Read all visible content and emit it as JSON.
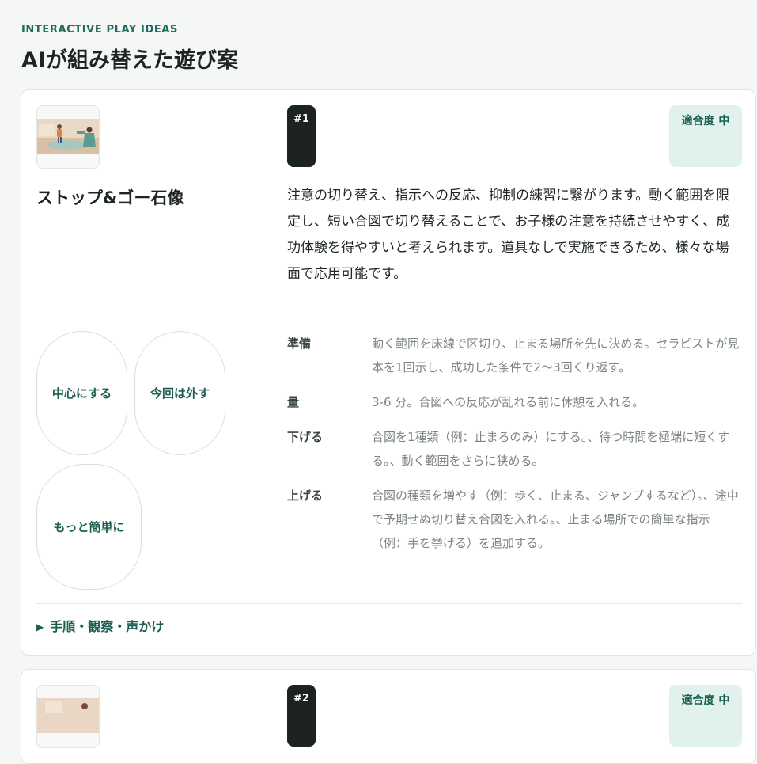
{
  "header": {
    "eyebrow": "INTERACTIVE PLAY IDEAS",
    "title": "AIが組み替えた遊び案"
  },
  "cards": [
    {
      "index_label": "#1",
      "fit_label": "適合度 中",
      "title": "ストップ&ゴー石像",
      "summary": "注意の切り替え、指示への反応、抑制の練習に繋がります。動く範囲を限定し、短い合図で切り替えることで、お子様の注意を持続させやすく、成功体験を得やすいと考えられます。道具なしで実施できるため、様々な場面で応用可能です。",
      "actions": [
        "中心にする",
        "今回は外す",
        "もっと簡単に"
      ],
      "details": [
        {
          "term": "準備",
          "text": "動く範囲を床線で区切り、止まる場所を先に決める。セラピストが見本を1回示し、成功した条件で2〜3回くり返す。"
        },
        {
          "term": "量",
          "text": "3-6 分。合図への反応が乱れる前に休憩を入れる。"
        },
        {
          "term": "下げる",
          "text": "合図を1種類（例：止まるのみ）にする。、待つ時間を極端に短くする。、動く範囲をさらに狭める。"
        },
        {
          "term": "上げる",
          "text": "合図の種類を増やす（例：歩く、止まる、ジャンプするなど）。、途中で予期せぬ切り替え合図を入れる。、止まる場所での簡単な指示（例：手を挙げる）を追加する。"
        }
      ],
      "expand_label": "手順・観察・声かけ"
    },
    {
      "index_label": "#2",
      "fit_label": "適合度 中"
    }
  ],
  "colors": {
    "accent": "#1b5e52",
    "badge_dark": "#1c2220",
    "fit_bg": "#e1f1ec",
    "page_bg": "#f5f6f6"
  },
  "icons": {
    "expand": "triangle-right-icon"
  }
}
